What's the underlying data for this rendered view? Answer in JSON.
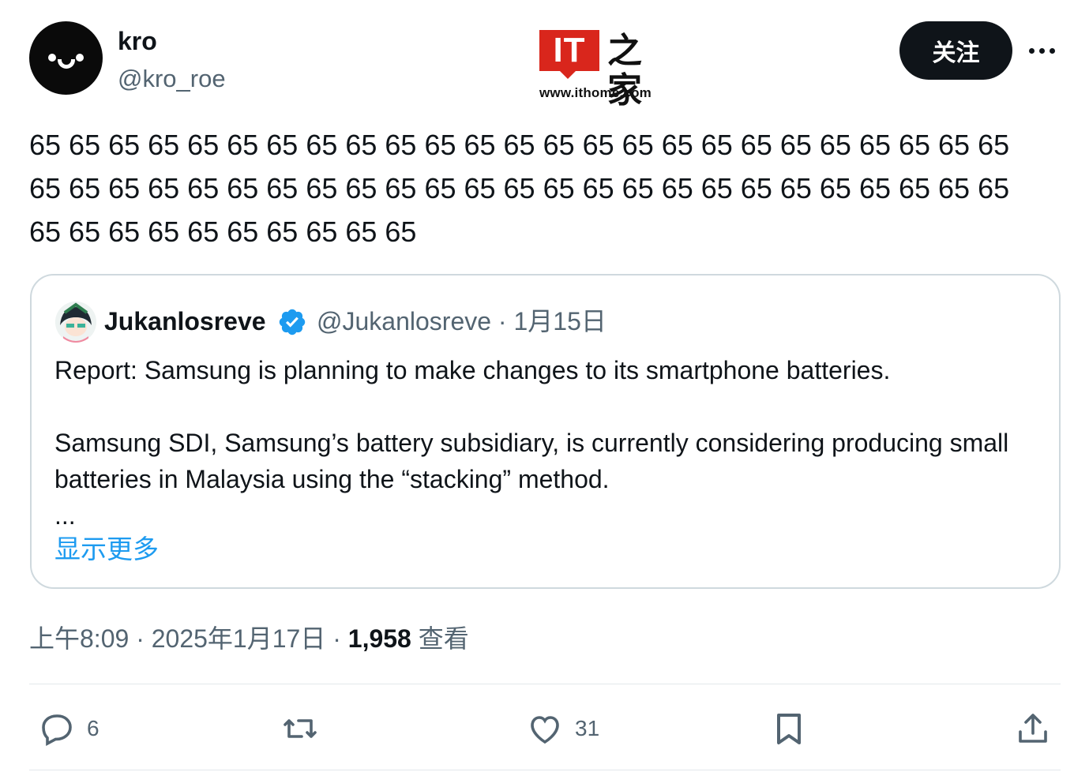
{
  "author": {
    "display_name": "kro",
    "handle": "@kro_roe"
  },
  "logo": {
    "it_text": "IT",
    "home_text": "之家",
    "url": "www.ithome.com"
  },
  "header": {
    "follow_label": "关注"
  },
  "tweet": {
    "text": "65 65 65 65 65 65 65 65 65 65 65 65 65 65 65 65 65 65 65 65 65 65 65 65 65 65 65 65 65 65 65 65 65 65 65 65 65 65 65 65 65 65 65 65 65 65 65 65 65 65 65 65 65 65 65 65 65 65 65 65"
  },
  "quote": {
    "name": "Jukanlosreve",
    "handle": "@Jukanlosreve",
    "date": "1月15日",
    "line1": "Report: Samsung is planning to make changes to its smartphone batteries.",
    "line2": "Samsung SDI, Samsung’s battery subsidiary, is currently considering producing small batteries in Malaysia using the “stacking” method.",
    "line3": "...",
    "show_more": "显示更多"
  },
  "meta": {
    "time": "上午8:09",
    "date": "2025年1月17日",
    "views_count": "1,958",
    "views_label": "查看"
  },
  "actions": {
    "replies": "6",
    "likes": "31"
  },
  "colors": {
    "accent": "#1d9bf0",
    "secondary_text": "#536471",
    "logo_red": "#d9261c"
  }
}
